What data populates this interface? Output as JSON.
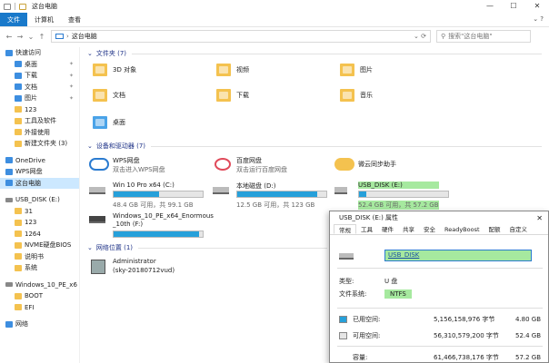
{
  "window": {
    "title": "这台电脑",
    "min": "—",
    "max": "☐",
    "close": "✕"
  },
  "ribbon": {
    "tabs": [
      "文件",
      "计算机",
      "查看"
    ]
  },
  "address": {
    "path": "这台电脑",
    "search_placeholder": "搜索\"这台电脑\""
  },
  "sidebar": {
    "items": [
      {
        "label": "快速访问",
        "icon": "star-icon",
        "indent": 1
      },
      {
        "label": "桌面",
        "icon": "desktop-icon",
        "indent": 2,
        "pin": "📌"
      },
      {
        "label": "下载",
        "icon": "download-icon",
        "indent": 2,
        "pin": "📌"
      },
      {
        "label": "文档",
        "icon": "document-icon",
        "indent": 2,
        "pin": "📌"
      },
      {
        "label": "图片",
        "icon": "picture-icon",
        "indent": 2,
        "pin": "📌"
      },
      {
        "label": "123",
        "icon": "folder-icon",
        "indent": 2
      },
      {
        "label": "工具及软件",
        "icon": "folder-icon",
        "indent": 2
      },
      {
        "label": "外接使用",
        "icon": "folder-icon",
        "indent": 2
      },
      {
        "label": "新建文件夹 (3)",
        "icon": "folder-icon",
        "indent": 2
      },
      {
        "label": "",
        "icon": "",
        "indent": 0
      },
      {
        "label": "OneDrive",
        "icon": "cloud-icon",
        "indent": 1
      },
      {
        "label": "WPS网盘",
        "icon": "cloud-icon",
        "indent": 1
      },
      {
        "label": "这台电脑",
        "icon": "computer-icon",
        "indent": 1,
        "selected": true
      },
      {
        "label": "",
        "icon": "",
        "indent": 0
      },
      {
        "label": "USB_DISK (E:)",
        "icon": "usb-drive-icon",
        "indent": 1
      },
      {
        "label": "31",
        "icon": "folder-icon",
        "indent": 2
      },
      {
        "label": "123",
        "icon": "folder-icon",
        "indent": 2
      },
      {
        "label": "1264",
        "icon": "folder-icon",
        "indent": 2
      },
      {
        "label": "NVME硬盘BIOS",
        "icon": "folder-icon",
        "indent": 2
      },
      {
        "label": "说明书",
        "icon": "folder-icon",
        "indent": 2
      },
      {
        "label": "系统",
        "icon": "folder-icon",
        "indent": 2
      },
      {
        "label": "",
        "icon": "",
        "indent": 0
      },
      {
        "label": "Windows_10_PE_x6",
        "icon": "disc-drive-icon",
        "indent": 1
      },
      {
        "label": "BOOT",
        "icon": "folder-icon",
        "indent": 2
      },
      {
        "label": "EFI",
        "icon": "folder-icon",
        "indent": 2
      },
      {
        "label": "",
        "icon": "",
        "indent": 0
      },
      {
        "label": "网络",
        "icon": "network-icon",
        "indent": 1
      }
    ]
  },
  "groups": {
    "folders": "文件夹 (7)",
    "devices": "设备和驱动器 (7)",
    "network": "网络位置 (1)"
  },
  "folders": [
    "3D 对象",
    "视频",
    "图片",
    "文档",
    "下载",
    "音乐",
    "桌面"
  ],
  "devices": {
    "wps": {
      "name": "WPS网盘",
      "sub": "双击进入WPS网盘"
    },
    "baidu": {
      "name": "百度网盘",
      "sub": "双击运行百度网盘"
    },
    "weiyun": {
      "name": "微云同步助手"
    },
    "c": {
      "name": "Win 10 Pro x64 (C:)",
      "free": "48.4 GB 可用，共 99.1 GB",
      "usage": 0.51
    },
    "d": {
      "name": "本地磁盘 (D:)",
      "free": "12.5 GB 可用，共 123 GB",
      "usage": 0.9
    },
    "e": {
      "name": "USB_DISK (E:)",
      "free": "52.4 GB 可用，共 57.2 GB",
      "usage": 0.08
    },
    "f": {
      "name": "Windows_10_PE_x64_Enormous",
      "name2": "_10th (F:)",
      "usage": 0.96
    }
  },
  "network_loc": {
    "name": "Administrator",
    "sub": "(sky-20180712vud)"
  },
  "dialog": {
    "title": "USB_DISK (E:) 属性",
    "close": "✕",
    "tabs": [
      "常规",
      "工具",
      "硬件",
      "共享",
      "安全",
      "ReadyBoost",
      "配额",
      "自定义"
    ],
    "label_value": "USB_DISK",
    "type_label": "类型:",
    "type_value": "U 盘",
    "fs_label": "文件系统:",
    "fs_value": "NTFS",
    "used_label": "已用空间:",
    "used_bytes": "5,156,158,976 字节",
    "used_gb": "4.80 GB",
    "free_label": "可用空间:",
    "free_bytes": "56,310,579,200 字节",
    "free_gb": "52.4 GB",
    "cap_label": "容量:",
    "cap_bytes": "61,466,738,176 字节",
    "cap_gb": "57.2 GB"
  },
  "colors": {
    "accent": "#1979ca",
    "highlight": "#a6e99f",
    "bar": "#26a0da",
    "selected": "#cce8ff"
  }
}
